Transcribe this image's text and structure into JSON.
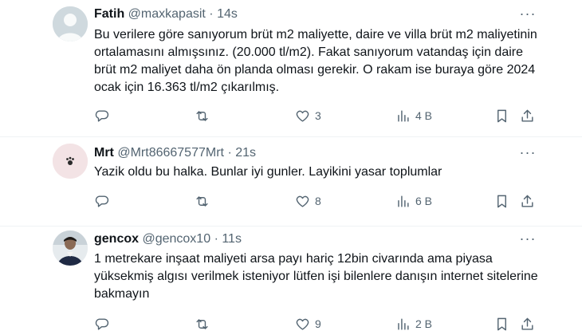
{
  "tweets": [
    {
      "name": "Fatih",
      "handle": "@maxkapasit",
      "sep": "·",
      "time": "14s",
      "text": "Bu verilere göre sanıyorum brüt m2 maliyette, daire ve villa brüt m2 maliyetinin ortalamasını almışsınız. (20.000 tl/m2). Fakat sanıyorum vatandaş için daire brüt m2 maliyet daha ön planda olması gerekir. O rakam ise buraya göre 2024 ocak için 16.363 tl/m2 çıkarılmış.",
      "replies": "",
      "retweets": "",
      "likes": "3",
      "views": "4 B",
      "avatar": "default-avatar"
    },
    {
      "name": "Mrt",
      "handle": "@Mrt86667577Mrt",
      "sep": "·",
      "time": "21s",
      "text": "Yazik oldu bu halka. Bunlar iyi gunler. Layikini yasar toplumlar",
      "replies": "",
      "retweets": "",
      "likes": "8",
      "views": "6 B",
      "avatar": "paw-avatar"
    },
    {
      "name": "gencox",
      "handle": "@gencox10",
      "sep": "·",
      "time": "11s",
      "text": "1 metrekare inşaat maliyeti arsa payı hariç 12bin civarında ama piyasa yüksekmiş algısı verilmek isteniyor lütfen işi bilenlere danışın internet sitelerine bakmayın",
      "replies": "",
      "retweets": "",
      "likes": "9",
      "views": "2 B",
      "avatar": "photo-avatar"
    }
  ],
  "more_glyph": "···",
  "colors": {
    "text": "#0f1419",
    "muted": "#536471",
    "divider": "#eff3f4",
    "avatar_default_bg": "#cfd9de",
    "paw_bg": "#f3e3e5"
  }
}
